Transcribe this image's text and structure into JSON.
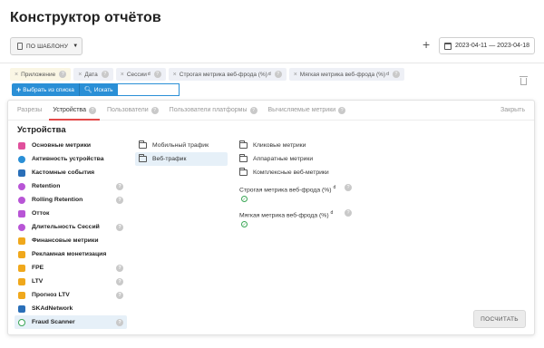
{
  "page": {
    "title": "Конструктор отчётов"
  },
  "toolbar": {
    "template_label": "ПО ШАБЛОНУ",
    "plus": "+",
    "date_range": "2023-04-11 — 2023-04-18"
  },
  "chips": [
    {
      "label": "Приложение",
      "sup": ""
    },
    {
      "label": "Дата",
      "sup": ""
    },
    {
      "label": "Сессии",
      "sup": "d"
    },
    {
      "label": "Строгая метрика веб-фрода (%)",
      "sup": "d"
    },
    {
      "label": "Мягкая метрика веб-фрода (%)",
      "sup": "d"
    }
  ],
  "add_bar": {
    "pick_label": "Выбрать из списка",
    "search_label": "Искать",
    "search_value": ""
  },
  "tabs": [
    {
      "label": "Разрезы"
    },
    {
      "label": "Устройства"
    },
    {
      "label": "Пользователи"
    },
    {
      "label": "Пользователи платформы"
    },
    {
      "label": "Вычисляемые метрики"
    }
  ],
  "panel": {
    "close_label": "Закрыть",
    "section_title": "Устройства",
    "apply_label": "ПОСЧИТАТЬ",
    "metric_groups": [
      {
        "label": "Основные метрики",
        "icon": "bars-icon",
        "color": "#e0509c"
      },
      {
        "label": "Активность устройства",
        "icon": "activity-icon",
        "color": "#2a8fd6"
      },
      {
        "label": "Кастомные события",
        "icon": "events-icon",
        "color": "#2a6fb8"
      },
      {
        "label": "Retention",
        "icon": "retention-icon",
        "color": "#b855d6"
      },
      {
        "label": "Rolling Retention",
        "icon": "rolling-retention-icon",
        "color": "#b855d6"
      },
      {
        "label": "Отток",
        "icon": "churn-icon",
        "color": "#b855d6"
      },
      {
        "label": "Длительность Сессий",
        "icon": "clock-icon",
        "color": "#b855d6"
      },
      {
        "label": "Финансовые метрики",
        "icon": "wallet-icon",
        "color": "#f0a81c"
      },
      {
        "label": "Рекламная монетизация",
        "icon": "ads-icon",
        "color": "#f0a81c"
      },
      {
        "label": "FPE",
        "icon": "fpe-icon",
        "color": "#f0a81c"
      },
      {
        "label": "LTV",
        "icon": "ltv-icon",
        "color": "#f0a81c"
      },
      {
        "label": "Прогноз LTV",
        "icon": "forecast-icon",
        "color": "#f0a81c"
      },
      {
        "label": "SKAdNetwork",
        "icon": "skad-icon",
        "color": "#2a6fb8"
      },
      {
        "label": "Fraud Scanner",
        "icon": "shield-icon",
        "color": "#3aa655"
      }
    ],
    "folders": [
      {
        "label": "Мобильный трафик"
      },
      {
        "label": "Веб-трафик"
      }
    ],
    "subfolders": [
      {
        "label": "Кликовые метрики"
      },
      {
        "label": "Аппаратные метрики"
      },
      {
        "label": "Комплексные веб-метрики"
      }
    ],
    "metrics": [
      {
        "label": "Строгая метрика веб-фрода (%)",
        "sup": "d"
      },
      {
        "label": "Мягкая метрика веб-фрода (%)",
        "sup": "d"
      }
    ]
  }
}
